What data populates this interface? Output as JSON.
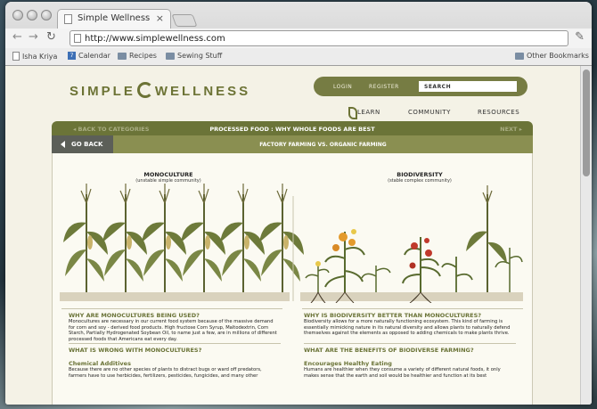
{
  "browser": {
    "tab_title": "Simple Wellness",
    "tab_close": "×",
    "url": "http://www.simplewellness.com",
    "bookmarks": [
      "Isha Kriya",
      "Calendar",
      "Recipes",
      "Sewing Stuff"
    ],
    "other_bookmarks": "Other Bookmarks",
    "calendar_icon": "7"
  },
  "site": {
    "logo_left": "SIMPLE",
    "logo_right": "WELLNESS",
    "login": "LOGIN",
    "register": "REGISTER",
    "search_placeholder": "SEARCH",
    "nav": [
      "LEARN",
      "COMMUNITY",
      "RESOURCES"
    ]
  },
  "topbar": {
    "back": "◂ BACK TO CATEGORIES",
    "title": "PROCESSED FOOD : WHY WHOLE FOODS ARE BEST",
    "next": "NEXT ▸"
  },
  "subbar": {
    "go_back": "GO BACK",
    "title": "FACTORY FARMING VS. ORGANIC FARMING"
  },
  "illustration": {
    "mono_title": "MONOCULTURE",
    "mono_sub": "(unstable simple community)",
    "bio_title": "BIODIVERSITY",
    "bio_sub": "(stable complex community)"
  },
  "left_col": {
    "q1": "WHY ARE MONOCULTURES BEING USED?",
    "p1": "Monocultures are necessary in our current food system because of the massive demand for corn and soy - derived food products. High fructose Corn Syrup, Maltodextrin, Corn Starch, Partially Hydrogenated Soybean Oil, to name just a few, are in millions of different processed foods that Americans eat every day.",
    "q2": "WHAT IS WRONG WITH MONOCULTURES?",
    "h3": "Chemical Additives",
    "p3": "Because there are no other species of plants to distract bugs or ward off predators, farmers have to use herbicides, fertilizers, pesticides, fungicides, and many other"
  },
  "right_col": {
    "q1": "WHY IS BIODIVERSITY BETTER THAN MONOCULTURES?",
    "p1": "Biodiversity allows for a more naturally functioning ecosystem. This kind of farming is essentially mimicking nature in its natural diversity and allows plants to naturally defend themselves against the elements as opposed to adding chemicals to make plants thrive.",
    "q2": "WHAT ARE THE BENEFITS OF BIODIVERSE FARMING?",
    "h3": "Encourages Healthy Eating",
    "p3": "Humans are healthier when they consume a variety of different natural foods, it only makes sense that the earth and soil would be healthier and function at its best"
  },
  "colors": {
    "accent": "#6b7438",
    "accent_light": "#8a8f51",
    "page_bg": "#f4f2e6"
  }
}
